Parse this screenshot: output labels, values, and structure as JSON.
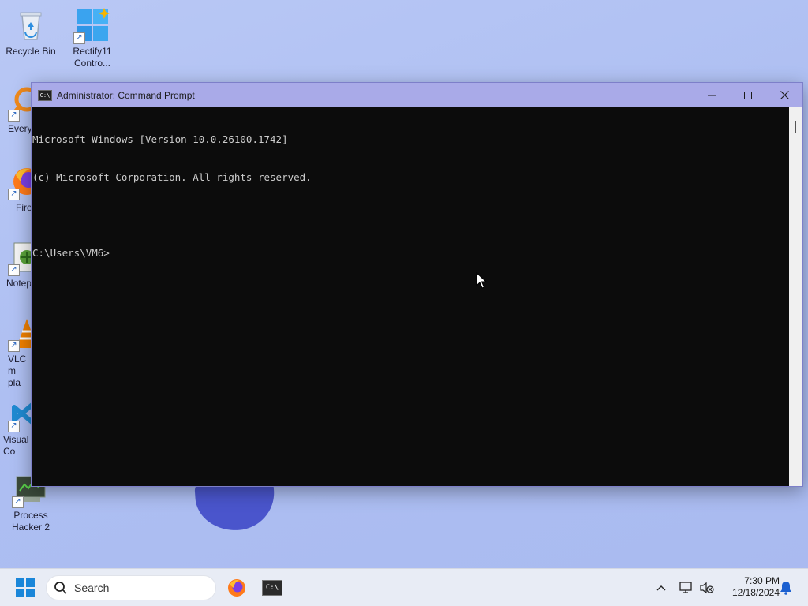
{
  "desktop": {
    "icons": [
      {
        "name": "recycle-bin",
        "label": "Recycle Bin",
        "icon": "recycle-bin-icon"
      },
      {
        "name": "rectify11",
        "label": "Rectify11 Contro...",
        "icon": "control-panel-icon"
      },
      {
        "name": "everything",
        "label": "Every",
        "icon": "everything-icon"
      },
      {
        "name": "firefox",
        "label": "Fire",
        "icon": "firefox-icon"
      },
      {
        "name": "notepad",
        "label": "Notep",
        "icon": "notepad-icon"
      },
      {
        "name": "vlc",
        "label": "VLC m pla",
        "icon": "vlc-icon"
      },
      {
        "name": "vscode",
        "label": "Visual Co",
        "icon": "vscode-icon"
      },
      {
        "name": "process-hacker",
        "label": "Process Hacker 2",
        "icon": "process-hacker-icon"
      }
    ]
  },
  "window": {
    "title": "Administrator: Command Prompt",
    "app_icon_text": "C:\\",
    "console_lines": [
      "Microsoft Windows [Version 10.0.26100.1742]",
      "(c) Microsoft Corporation. All rights reserved.",
      "",
      "C:\\Users\\VM6>"
    ]
  },
  "taskbar": {
    "search_placeholder": "Search",
    "cmd_icon_text": "C:\\",
    "time": "7:30 PM",
    "date": "12/18/2024"
  },
  "colors": {
    "accent": "#0067c0",
    "titlebar": "#a9aae8",
    "console_bg": "#0c0c0c",
    "console_text": "#cccccc"
  }
}
